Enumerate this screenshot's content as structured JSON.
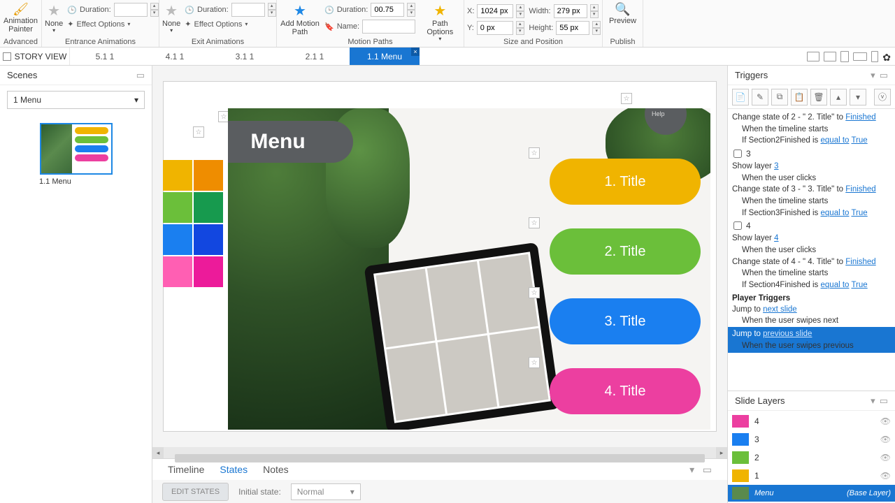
{
  "ribbon": {
    "painter": {
      "l1": "Animation",
      "l2": "Painter",
      "group": "Advanced"
    },
    "entrance": {
      "none": "None",
      "effect": "Effect Options",
      "duration_label": "Duration:",
      "duration": "",
      "group": "Entrance Animations"
    },
    "exit": {
      "none": "None",
      "effect": "Effect Options",
      "duration_label": "Duration:",
      "duration": "",
      "group": "Exit Animations"
    },
    "motion": {
      "add1": "Add Motion",
      "add2": "Path",
      "duration_label": "Duration:",
      "duration": "00.75",
      "name_label": "Name:",
      "name": "",
      "path_opt": "Path Options",
      "group": "Motion Paths"
    },
    "sizepos": {
      "x_label": "X:",
      "x": "1024 px",
      "y_label": "Y:",
      "y": "0 px",
      "w_label": "Width:",
      "w": "279 px",
      "h_label": "Height:",
      "h": "55 px",
      "group": "Size and Position"
    },
    "publish": {
      "preview": "Preview",
      "group": "Publish"
    }
  },
  "tabs": {
    "story": "STORY VIEW",
    "items": [
      "5.1 1",
      "4.1 1",
      "3.1 1",
      "2.1 1",
      "1.1 Menu"
    ],
    "active_index": 4
  },
  "scenes": {
    "title": "Scenes",
    "dropdown": "1 Menu",
    "thumb_label": "1.1 Menu"
  },
  "slide": {
    "menu": "Menu",
    "help": "Help",
    "buttons": [
      {
        "label": "1. Title",
        "color": "#f0b400"
      },
      {
        "label": "2. Title",
        "color": "#6bbf3a"
      },
      {
        "label": "3. Title",
        "color": "#1a7ff0"
      },
      {
        "label": "4. Title",
        "color": "#ec3fa0"
      }
    ],
    "swatches": [
      "#f0b400",
      "#ef8d00",
      "#6bbf3a",
      "#179a4e",
      "#1a7ff0",
      "#1247e0",
      "#ff5fb3",
      "#ec1b9a"
    ]
  },
  "bottom": {
    "tabs": [
      "Timeline",
      "States",
      "Notes"
    ],
    "active": 1,
    "edit_states": "EDIT STATES",
    "initial_label": "Initial state:",
    "initial_value": "Normal"
  },
  "triggers": {
    "title": "Triggers",
    "items": [
      {
        "type": "change",
        "obj": "2 - \"   2. Title\"",
        "to": "Finished",
        "when": "When the timeline starts",
        "cond_var": "Section2Finished",
        "cond_op": "equal to",
        "cond_val": "True"
      },
      {
        "type": "chk",
        "label": "3"
      },
      {
        "type": "show",
        "layer": "3",
        "when": "When the user clicks"
      },
      {
        "type": "change",
        "obj": "3 - \"   3. Title\"",
        "to": "Finished",
        "when": "When the timeline starts",
        "cond_var": "Section3Finished",
        "cond_op": "equal to",
        "cond_val": "True"
      },
      {
        "type": "chk",
        "label": "4"
      },
      {
        "type": "show",
        "layer": "4",
        "when": "When the user clicks"
      },
      {
        "type": "change",
        "obj": "4 - \"   4. Title\"",
        "to": "Finished",
        "when": "When the timeline starts",
        "cond_var": "Section4Finished",
        "cond_op": "equal to",
        "cond_val": "True"
      }
    ],
    "player_head": "Player Triggers",
    "jump_next": {
      "target": "next slide",
      "when": "When the user swipes next"
    },
    "jump_prev": {
      "target": "previous slide",
      "when": "When the user swipes previous"
    }
  },
  "layers": {
    "title": "Slide Layers",
    "items": [
      {
        "label": "4",
        "color": "#ec3fa0"
      },
      {
        "label": "3",
        "color": "#1a7ff0"
      },
      {
        "label": "2",
        "color": "#6bbf3a"
      },
      {
        "label": "1",
        "color": "#f0b400"
      }
    ],
    "base_name": "Menu",
    "base_tag": "(Base Layer)"
  }
}
